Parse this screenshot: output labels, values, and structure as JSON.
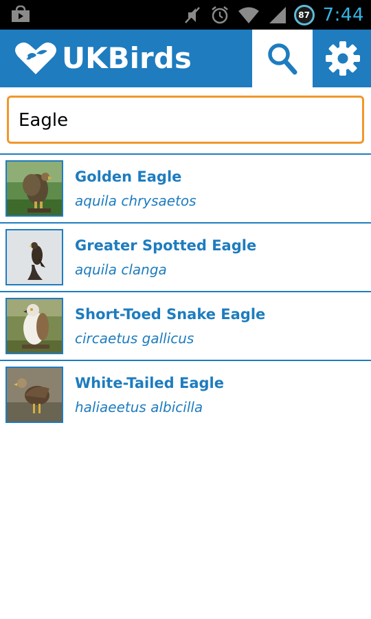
{
  "status_bar": {
    "time": "7:44",
    "battery": "87",
    "icons": [
      "play-store-icon",
      "mute-icon",
      "alarm-icon",
      "wifi-icon",
      "signal-icon",
      "battery-icon"
    ]
  },
  "action_bar": {
    "title": "UKBirds",
    "logo_icon": "heart-bird-logo",
    "actions": [
      "search-icon",
      "gear-icon"
    ],
    "colors": {
      "bar": "#1e7cbf",
      "search_active_bg": "#ffffff"
    }
  },
  "search": {
    "value": "Eagle",
    "border_color": "#f2962a"
  },
  "birds": [
    {
      "common_name": "Golden Eagle",
      "latin_name": "aquila chrysaetos"
    },
    {
      "common_name": "Greater Spotted Eagle",
      "latin_name": "aquila clanga"
    },
    {
      "common_name": "Short-Toed Snake Eagle",
      "latin_name": "circaetus gallicus"
    },
    {
      "common_name": "White-Tailed Eagle",
      "latin_name": "haliaeetus albicilla"
    }
  ],
  "colors": {
    "accent": "#1e7cbf",
    "clock": "#33b5e5"
  }
}
